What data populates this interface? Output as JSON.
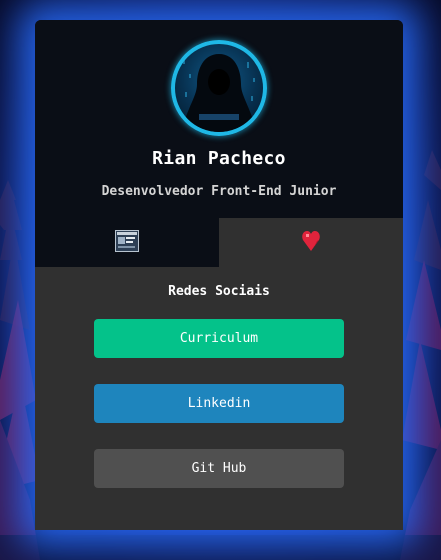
{
  "profile": {
    "name": "Rian Pacheco",
    "role": "Desenvolvedor Front-End Junior",
    "avatar_icon": "hooded-hacker-avatar"
  },
  "tabs": [
    {
      "icon": "terminal-window-icon",
      "active": false
    },
    {
      "icon": "heart-icon",
      "active": true
    }
  ],
  "social": {
    "title": "Redes Sociais",
    "buttons": [
      {
        "label": "Curriculum",
        "color": "#04c28a"
      },
      {
        "label": "Linkedin",
        "color": "#1e85bd"
      },
      {
        "label": "Git Hub",
        "color": "#505050"
      }
    ]
  },
  "colors": {
    "card_dark": "#0a0e16",
    "card_body": "#303030",
    "avatar_ring": "#1fb8e6",
    "glow": "#2a6cff",
    "heart": "#e0243c"
  }
}
